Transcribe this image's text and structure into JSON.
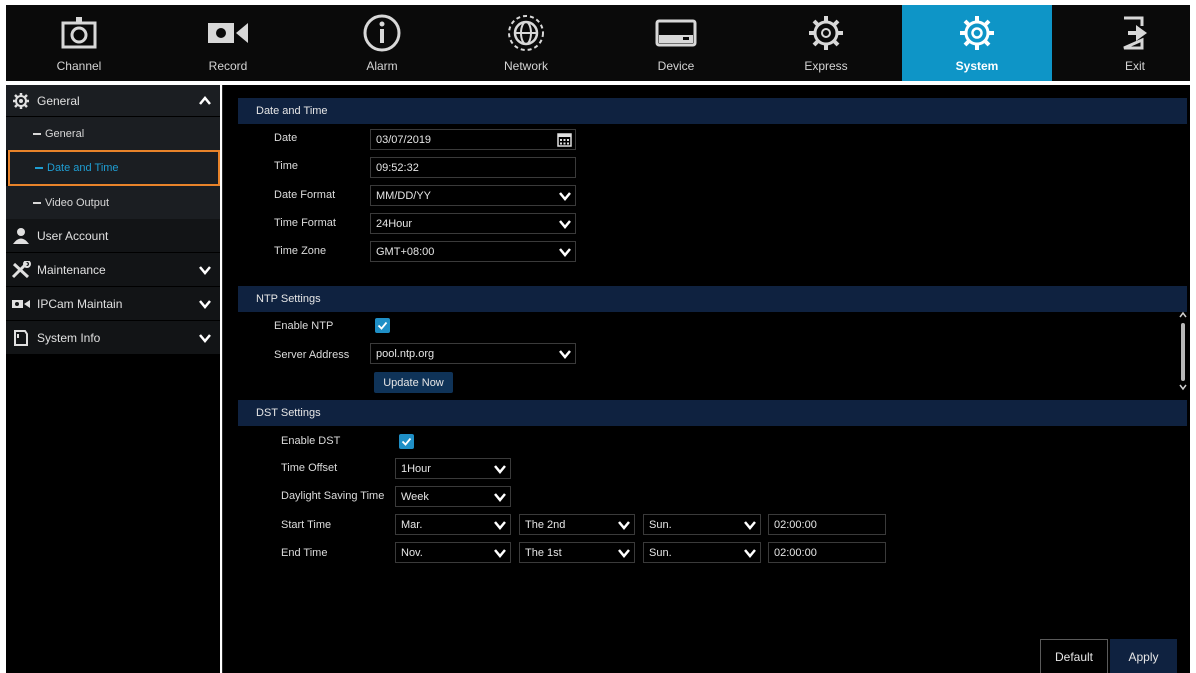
{
  "topnav": [
    {
      "label": "Channel",
      "icon": "channel-icon"
    },
    {
      "label": "Record",
      "icon": "record-camera-icon"
    },
    {
      "label": "Alarm",
      "icon": "alarm-info-icon"
    },
    {
      "label": "Network",
      "icon": "network-globe-icon"
    },
    {
      "label": "Device",
      "icon": "device-hdd-icon"
    },
    {
      "label": "Express",
      "icon": "express-gear-icon"
    },
    {
      "label": "System",
      "icon": "system-gear-icon",
      "active": true
    },
    {
      "label": "Exit",
      "icon": "exit-icon"
    }
  ],
  "sidebar": {
    "general": {
      "label": "General",
      "icon": "gear-icon"
    },
    "sub_items": [
      {
        "label": "General"
      },
      {
        "label": "Date and Time",
        "active": true
      },
      {
        "label": "Video Output"
      }
    ],
    "user_account": {
      "label": "User Account",
      "icon": "user-icon"
    },
    "maintenance": {
      "label": "Maintenance",
      "icon": "tools-icon"
    },
    "ipcam": {
      "label": "IPCam Maintain",
      "icon": "ipcam-icon"
    },
    "system_info": {
      "label": "System Info",
      "icon": "info-doc-icon"
    }
  },
  "date_time": {
    "section_title": "Date and Time",
    "date_label": "Date",
    "date_value": "03/07/2019",
    "time_label": "Time",
    "time_value": "09:52:32",
    "date_format_label": "Date Format",
    "date_format_value": "MM/DD/YY",
    "time_format_label": "Time Format",
    "time_format_value": "24Hour",
    "time_zone_label": "Time Zone",
    "time_zone_value": "GMT+08:00"
  },
  "ntp": {
    "section_title": "NTP Settings",
    "enable_label": "Enable NTP",
    "enabled": true,
    "server_label": "Server Address",
    "server_value": "pool.ntp.org",
    "update_button": "Update Now"
  },
  "dst": {
    "section_title": "DST Settings",
    "enable_label": "Enable DST",
    "enabled": true,
    "offset_label": "Time Offset",
    "offset_value": "1Hour",
    "mode_label": "Daylight Saving Time",
    "mode_value": "Week",
    "start_label": "Start Time",
    "start": {
      "month": "Mar.",
      "week": "The 2nd",
      "day": "Sun.",
      "time": "02:00:00"
    },
    "end_label": "End Time",
    "end": {
      "month": "Nov.",
      "week": "The 1st",
      "day": "Sun.",
      "time": "02:00:00"
    }
  },
  "footer": {
    "default_button": "Default",
    "apply_button": "Apply"
  },
  "colors": {
    "accent": "#0e95c7",
    "section_header": "#0f2240",
    "highlight_border": "#e8832a"
  }
}
